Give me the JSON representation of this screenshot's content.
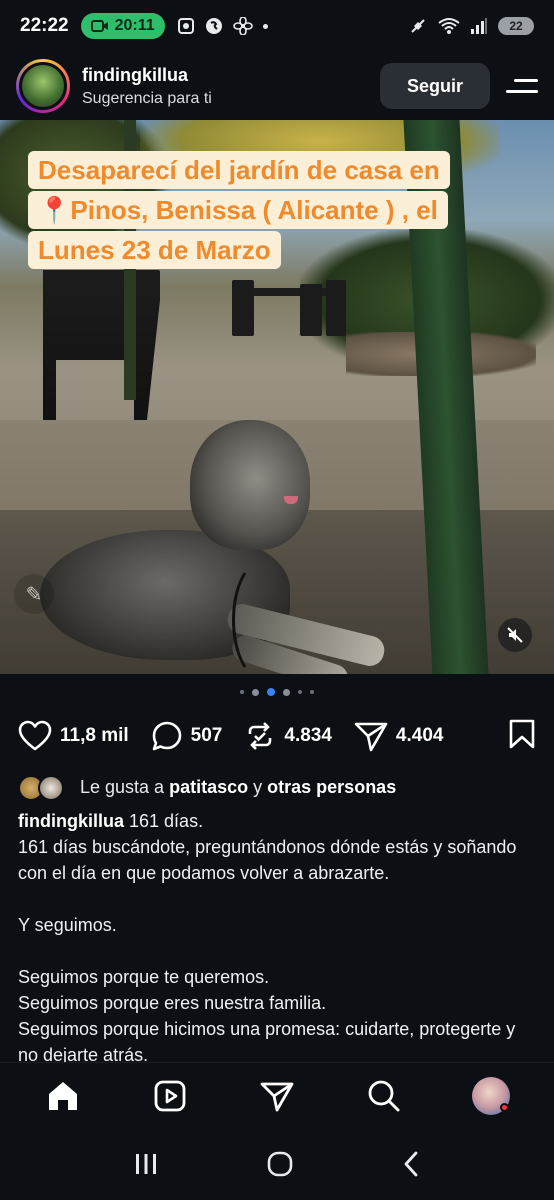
{
  "status_bar": {
    "time": "22:22",
    "call_timer": "20:11",
    "battery": "22"
  },
  "post": {
    "username": "findingkillua",
    "subtitle": "Sugerencia para ti",
    "follow_label": "Seguir",
    "image_caption_lines": [
      "Desaparecí del jardín de casa en",
      "📍Pinos, Benissa ( Alicante ) , el",
      "Lunes 23 de Marzo"
    ],
    "carousel": {
      "count": 6,
      "active_index": 2
    },
    "actions": {
      "likes": "11,8 mil",
      "comments": "507",
      "reposts": "4.834",
      "shares": "4.404"
    },
    "liked_by": {
      "prefix": "Le gusta a",
      "user": "patitasco",
      "connector": "y",
      "others": "otras personas"
    },
    "caption": {
      "user": "findingkillua",
      "first": "161 días.",
      "lines": [
        "161 días buscándote, preguntándonos dónde estás y soñando con el día en que podamos volver a abrazarte.",
        "",
        "Y seguimos.",
        "",
        "Seguimos porque te queremos.",
        "Seguimos porque eres nuestra familia.",
        "Seguimos porque hicimos una promesa: cuidarte, protegerte y no dejarte atrás."
      ]
    }
  },
  "colors": {
    "background": "#0c0f14",
    "overlay_text": "#f08a2a",
    "overlay_bg": "#fbefd8",
    "call_pill": "#2fbf6c",
    "carousel_active": "#3b82f6",
    "notification": "#ff3040"
  },
  "icons": {
    "nav": [
      "home-icon",
      "reels-icon",
      "send-icon",
      "search-icon",
      "profile-avatar"
    ],
    "system": [
      "recents-icon",
      "home-circle-icon",
      "back-icon"
    ]
  }
}
